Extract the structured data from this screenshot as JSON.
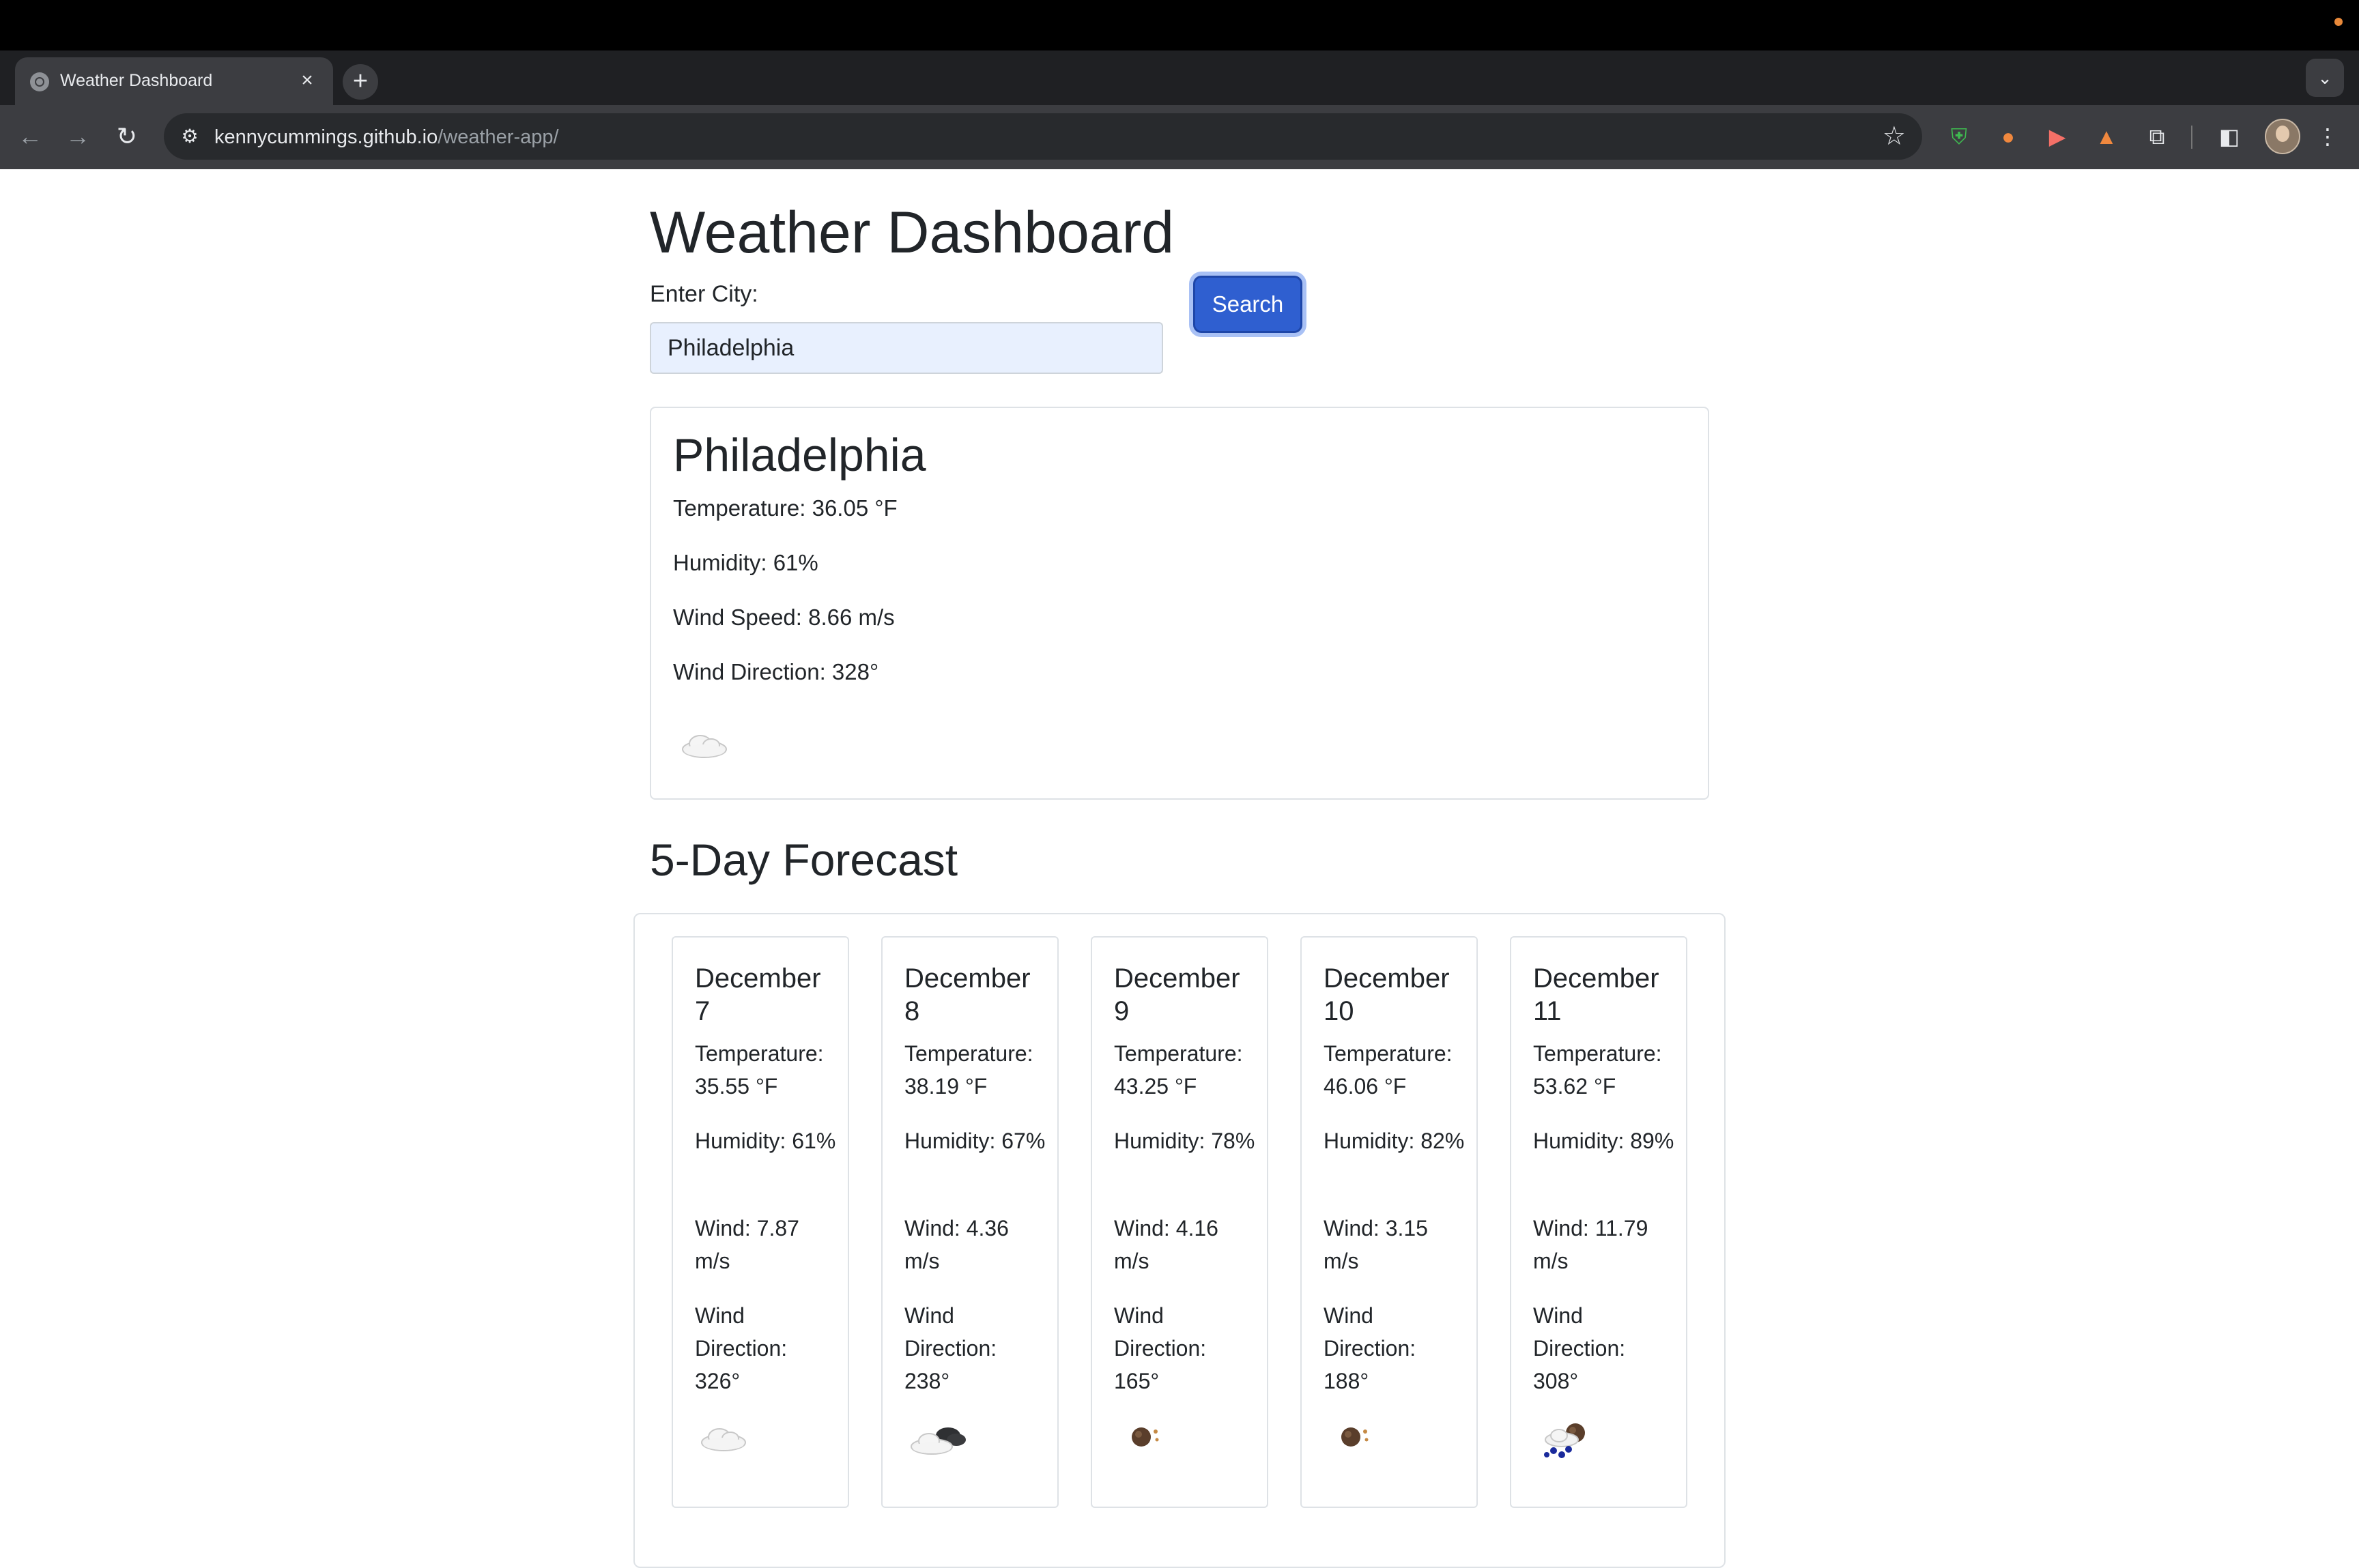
{
  "browser": {
    "tab_title": "Weather Dashboard",
    "tab_close": "×",
    "new_tab": "+",
    "tab_search": "⌄",
    "url_host": "kennycummings.github.io",
    "url_path": "/weather-app/"
  },
  "page": {
    "title": "Weather Dashboard",
    "city_label": "Enter City:",
    "city_value": "Philadelphia",
    "search_button": "Search"
  },
  "current": {
    "city": "Philadelphia",
    "temperature": "Temperature: 36.05 °F",
    "humidity": "Humidity: 61%",
    "wind_speed": "Wind Speed: 8.66 m/s",
    "wind_direction": "Wind Direction: 328°",
    "icon": "cloud-icon"
  },
  "forecast": {
    "title": "5-Day Forecast",
    "days": [
      {
        "date": "December 7",
        "temperature": "Temperature: 35.55 °F",
        "humidity": "Humidity: 61%",
        "wind": "Wind: 7.87 m/s",
        "direction": "Wind Direction: 326°",
        "icon": "cloud-icon"
      },
      {
        "date": "December 8",
        "temperature": "Temperature: 38.19 °F",
        "humidity": "Humidity: 67%",
        "wind": "Wind: 4.36 m/s",
        "direction": "Wind Direction: 238°",
        "icon": "dark-cloud-icon"
      },
      {
        "date": "December 9",
        "temperature": "Temperature: 43.25 °F",
        "humidity": "Humidity: 78%",
        "wind": "Wind: 4.16 m/s",
        "direction": "Wind Direction: 165°",
        "icon": "dark-sun-icon"
      },
      {
        "date": "December 10",
        "temperature": "Temperature: 46.06 °F",
        "humidity": "Humidity: 82%",
        "wind": "Wind: 3.15 m/s",
        "direction": "Wind Direction: 188°",
        "icon": "dark-sun-icon"
      },
      {
        "date": "December 11",
        "temperature": "Temperature: 53.62 °F",
        "humidity": "Humidity: 89%",
        "wind": "Wind: 11.79 m/s",
        "direction": "Wind Direction: 308°",
        "icon": "rain-cloud-icon"
      }
    ]
  }
}
